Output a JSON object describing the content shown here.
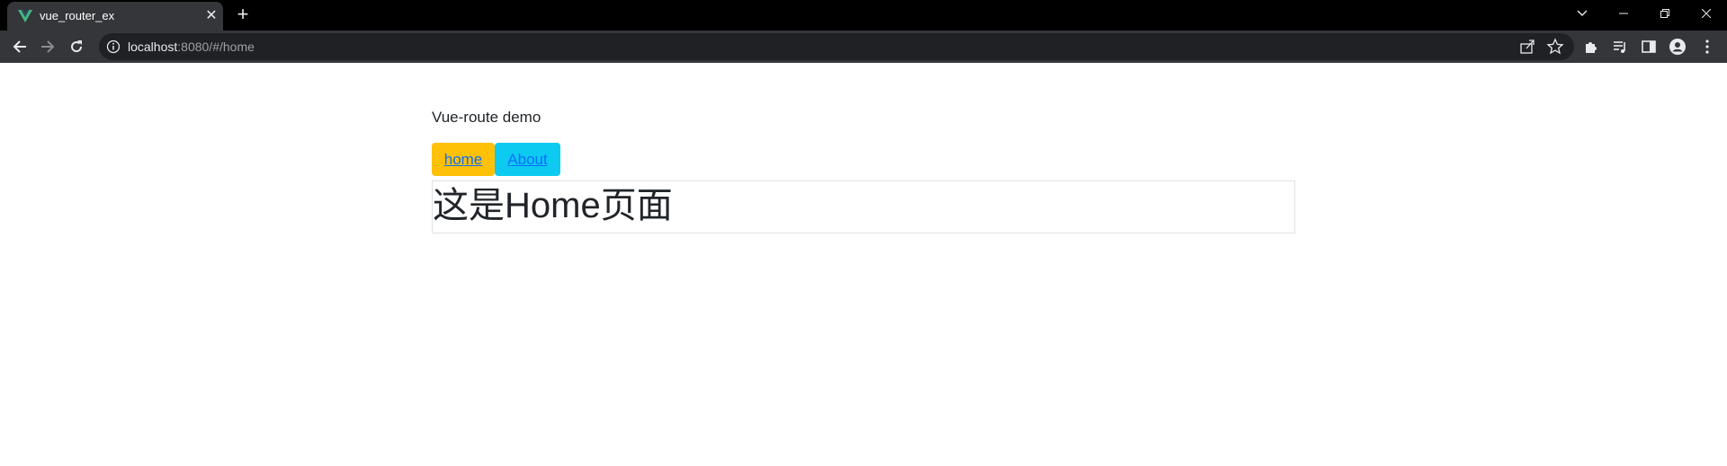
{
  "browser": {
    "tab_title": "vue_router_ex",
    "url_host": "localhost",
    "url_rest": ":8080/#/home"
  },
  "page": {
    "demo_title": "Vue-route demo",
    "nav": {
      "home_label": "home",
      "about_label": "About"
    },
    "content_heading": "这是Home页面"
  },
  "colors": {
    "home_button": "#ffc107",
    "about_button": "#0dcaf0",
    "link": "#0d6efd",
    "vue_green": "#41b883"
  }
}
